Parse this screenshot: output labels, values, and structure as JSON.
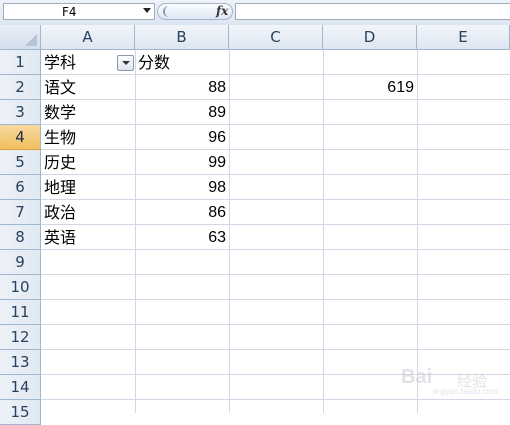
{
  "formula_bar": {
    "name_box": "F4",
    "fx_label": "fx",
    "formula": ""
  },
  "columns": [
    "A",
    "B",
    "C",
    "D",
    "E"
  ],
  "rows": [
    "1",
    "2",
    "3",
    "4",
    "5",
    "6",
    "7",
    "8",
    "9",
    "10",
    "11",
    "12",
    "13",
    "14",
    "15"
  ],
  "active_row": "4",
  "sheet": {
    "header_subject": "学科",
    "header_score": "分数",
    "records": [
      {
        "subject": "语文",
        "score": "88"
      },
      {
        "subject": "数学",
        "score": "89"
      },
      {
        "subject": "生物",
        "score": "96"
      },
      {
        "subject": "历史",
        "score": "99"
      },
      {
        "subject": "地理",
        "score": "98"
      },
      {
        "subject": "政治",
        "score": "86"
      },
      {
        "subject": "英语",
        "score": "63"
      }
    ],
    "d2_total": "619"
  },
  "watermark": {
    "brand": "Bai",
    "brand_suffix": "经验",
    "url": "jingyan.baidu.com"
  },
  "colors": {
    "header_bg": "#dde6f1",
    "grid_line": "#d0d7e5",
    "active_row_header": "#f1c15f"
  }
}
